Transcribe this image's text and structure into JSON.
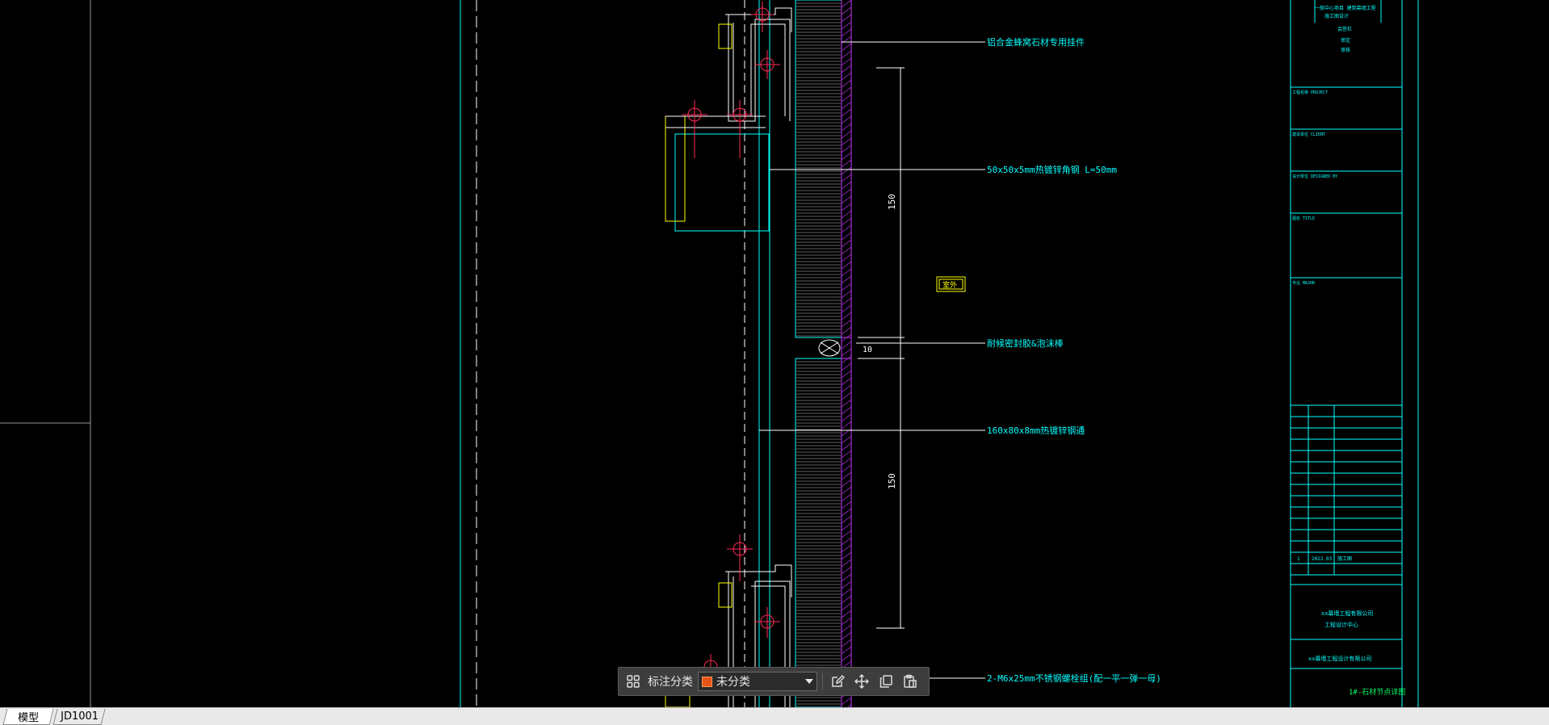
{
  "drawing": {
    "callouts": [
      "铝合金蜂窝石材专用挂件",
      "50x50x5mm热镀锌角钢 L=50mm",
      "耐候密封胶&泡沫棒",
      "160x80x8mm热镀锌钢通",
      "2-M6x25mm不锈钢螺栓组(配一平一弹一母)"
    ],
    "dimensions": [
      "150",
      "10",
      "150"
    ],
    "tag": "室外",
    "title_block": {
      "header_lines": [
        "一般中心项目 建筑幕墙工程",
        "施工图设计",
        "会签栏",
        "审定",
        "审核"
      ],
      "sections": [
        "工程名称 PROJECT",
        "建设单位 CLIENT",
        "设计单位 DESIGNED BY",
        "图名 TITLE",
        "专业 MAJOR"
      ],
      "revision_row": [
        "1",
        "2022.03",
        "施工图"
      ],
      "company_lines": [
        "xx幕墙工程有限公司",
        "工程设计中心"
      ],
      "project_name": "xx幕墙工程设计有限公司",
      "sheet_title": "1#-石材节点详图"
    }
  },
  "toolbar": {
    "grid_icon": "grid-icon",
    "category_label": "标注分类",
    "category_value": "未分类",
    "category_color": "#e8541a",
    "tools": [
      "edit-icon",
      "move-icon",
      "copy-icon",
      "paste-icon"
    ]
  },
  "tabs": [
    "模型",
    "JD1001"
  ],
  "colors": {
    "background": "#000000",
    "cyan": "#00ffff",
    "white": "#ffffff",
    "magenta": "#cc33ff",
    "red": "#ff2a55",
    "yellow": "#ffff00"
  }
}
